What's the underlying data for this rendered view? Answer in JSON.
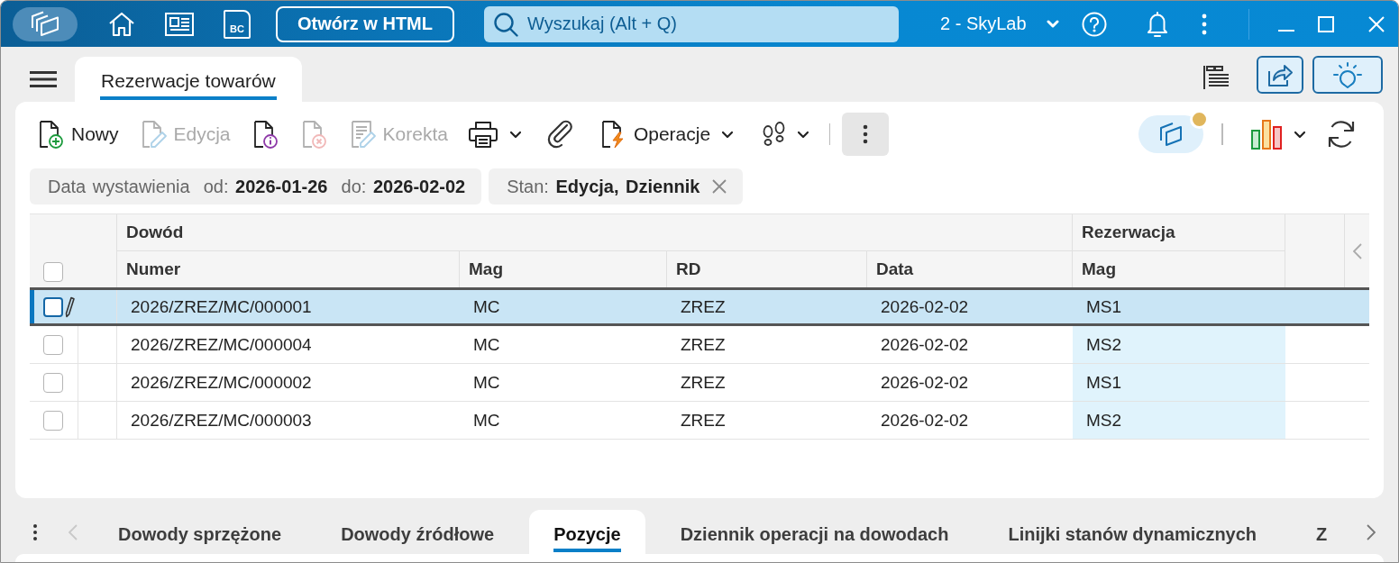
{
  "title_bar": {
    "bc_label": "BC",
    "open_html_button": "Otwórz w HTML",
    "search": {
      "placeholder": "Wyszukaj (Alt + Q)"
    },
    "company": "2 - SkyLab"
  },
  "tabs": [
    {
      "label": "Rezerwacje towarów",
      "selected": true
    }
  ],
  "toolbar": {
    "buttons": [
      {
        "label": "Nowy",
        "disabled": false
      },
      {
        "label": "Edycja",
        "disabled": true
      },
      {
        "disabled": false
      },
      {
        "disabled": true
      },
      {
        "label": "Korekta",
        "disabled": true
      }
    ],
    "operations_label": "Operacje",
    "workspace_notification": true
  },
  "filters": [
    {
      "text": "Data wystawienia  od: **2026-01-26**  do: **2026-02-02**",
      "removable": false
    },
    {
      "text": "Stan: **Edycja, Dziennik**",
      "removable": true
    }
  ],
  "table": {
    "all_checked": false,
    "column_groups": [
      {
        "label": "Dowód",
        "columns": [
          {
            "label": "Numer",
            "highlighted": false
          },
          {
            "label": "Mag",
            "highlighted": false
          },
          {
            "label": "RD",
            "highlighted": false
          },
          {
            "label": "Data",
            "highlighted": false
          }
        ]
      },
      {
        "label": "Rezerwacja",
        "columns": [
          {
            "label": "Mag",
            "highlighted": true
          }
        ]
      }
    ],
    "rows": [
      {
        "selected": true,
        "checked": false,
        "cells": [
          "2026/ZREZ/MC/000001",
          "MC",
          "ZREZ",
          "2026-02-02",
          "MS1"
        ]
      },
      {
        "selected": false,
        "checked": false,
        "cells": [
          "2026/ZREZ/MC/000004",
          "MC",
          "ZREZ",
          "2026-02-02",
          "MS2"
        ]
      },
      {
        "selected": false,
        "checked": false,
        "cells": [
          "2026/ZREZ/MC/000002",
          "MC",
          "ZREZ",
          "2026-02-02",
          "MS1"
        ]
      },
      {
        "selected": false,
        "checked": false,
        "cells": [
          "2026/ZREZ/MC/000003",
          "MC",
          "ZREZ",
          "2026-02-02",
          "MS2"
        ]
      }
    ]
  },
  "bottom_tabs": [
    {
      "label": "Dowody sprzężone",
      "selected": false
    },
    {
      "label": "Dowody źródłowe",
      "selected": false
    },
    {
      "label": "Pozycje",
      "selected": true
    },
    {
      "label": "Dziennik operacji na dowodach",
      "selected": false
    },
    {
      "label": "Linijki stanów dynamicznych",
      "selected": false
    },
    {
      "label": "Z",
      "selected": false
    }
  ]
}
